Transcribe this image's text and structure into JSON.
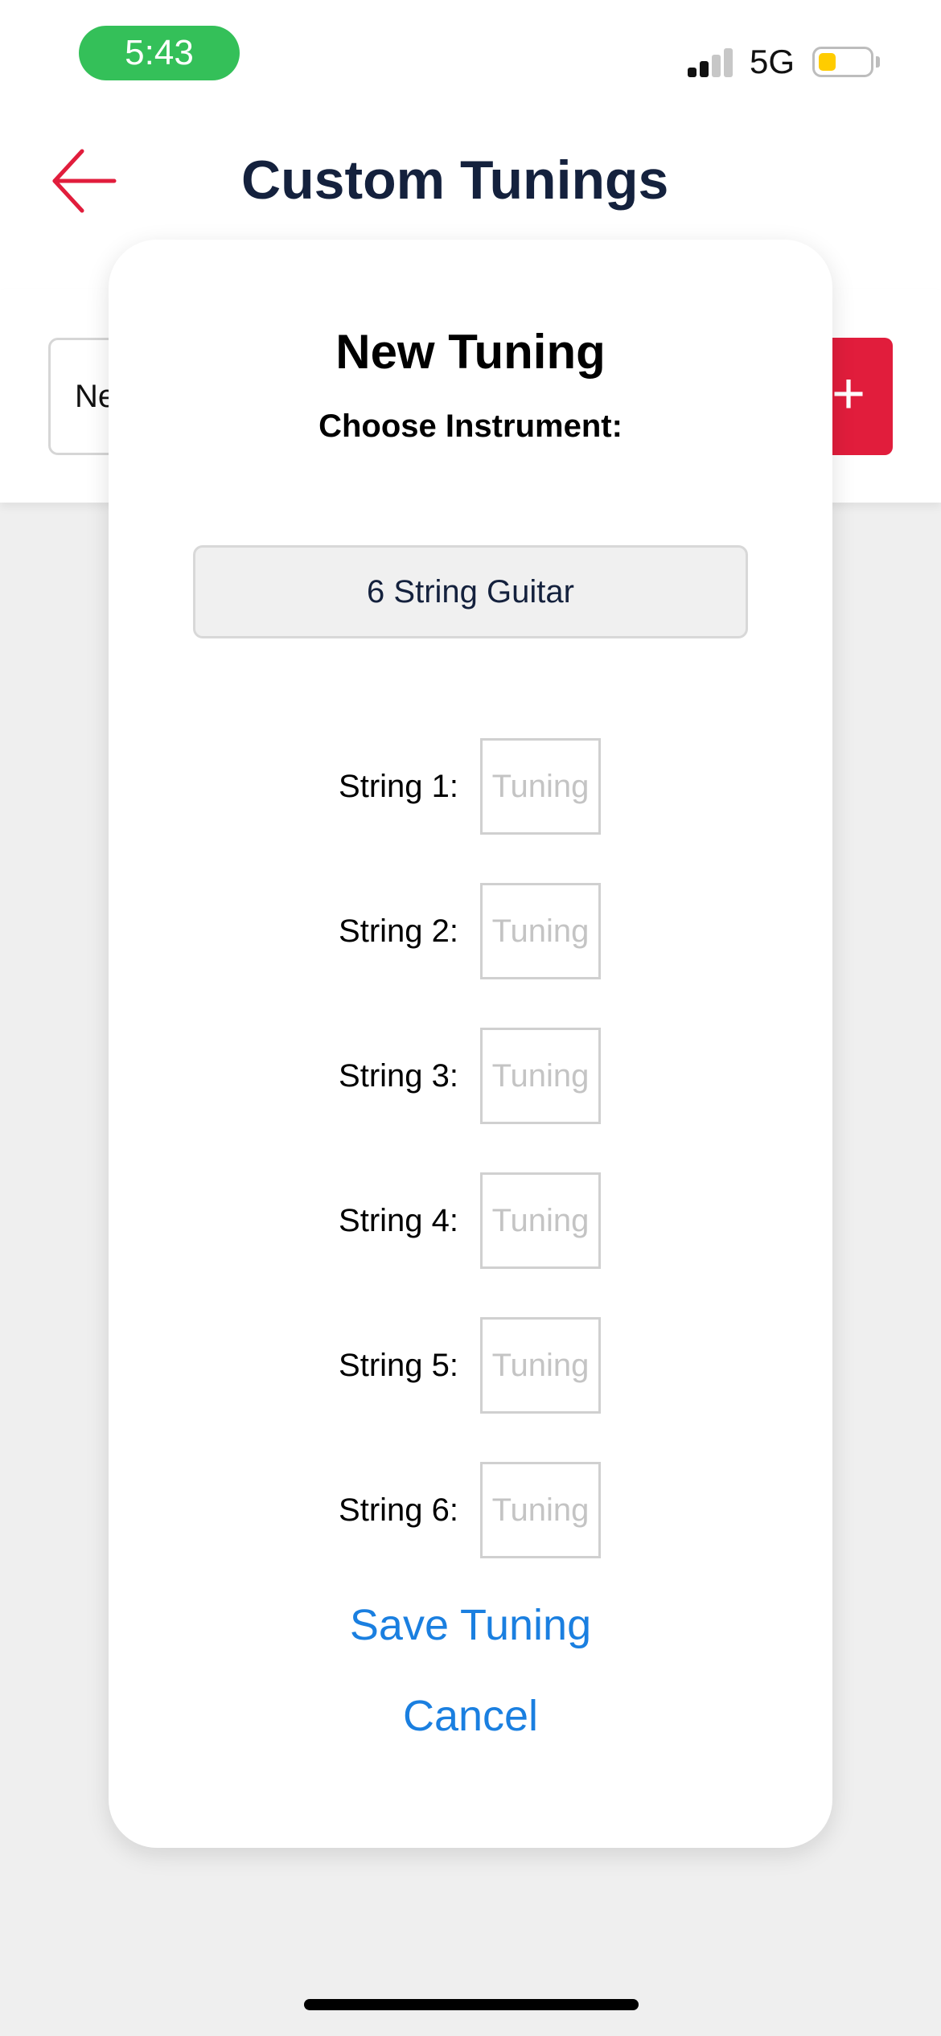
{
  "status_bar": {
    "time": "5:43",
    "network": "5G",
    "battery_level": 0.35,
    "time_pill_color": "#34c059",
    "battery_color": "#ffcc00"
  },
  "header": {
    "title": "Custom Tunings",
    "back_icon": "arrow-left-icon",
    "accent_color": "#e11d3c"
  },
  "input_row": {
    "name_value_visible": "Ne",
    "add_label": "+"
  },
  "modal": {
    "title": "New Tuning",
    "subtitle": "Choose Instrument:",
    "instrument": "6 String Guitar",
    "strings": [
      {
        "label": "String 1:",
        "placeholder": "Tuning"
      },
      {
        "label": "String 2:",
        "placeholder": "Tuning"
      },
      {
        "label": "String 3:",
        "placeholder": "Tuning"
      },
      {
        "label": "String 4:",
        "placeholder": "Tuning"
      },
      {
        "label": "String 5:",
        "placeholder": "Tuning"
      },
      {
        "label": "String 6:",
        "placeholder": "Tuning"
      }
    ],
    "save_label": "Save Tuning",
    "cancel_label": "Cancel",
    "link_color": "#1a7fe0"
  }
}
